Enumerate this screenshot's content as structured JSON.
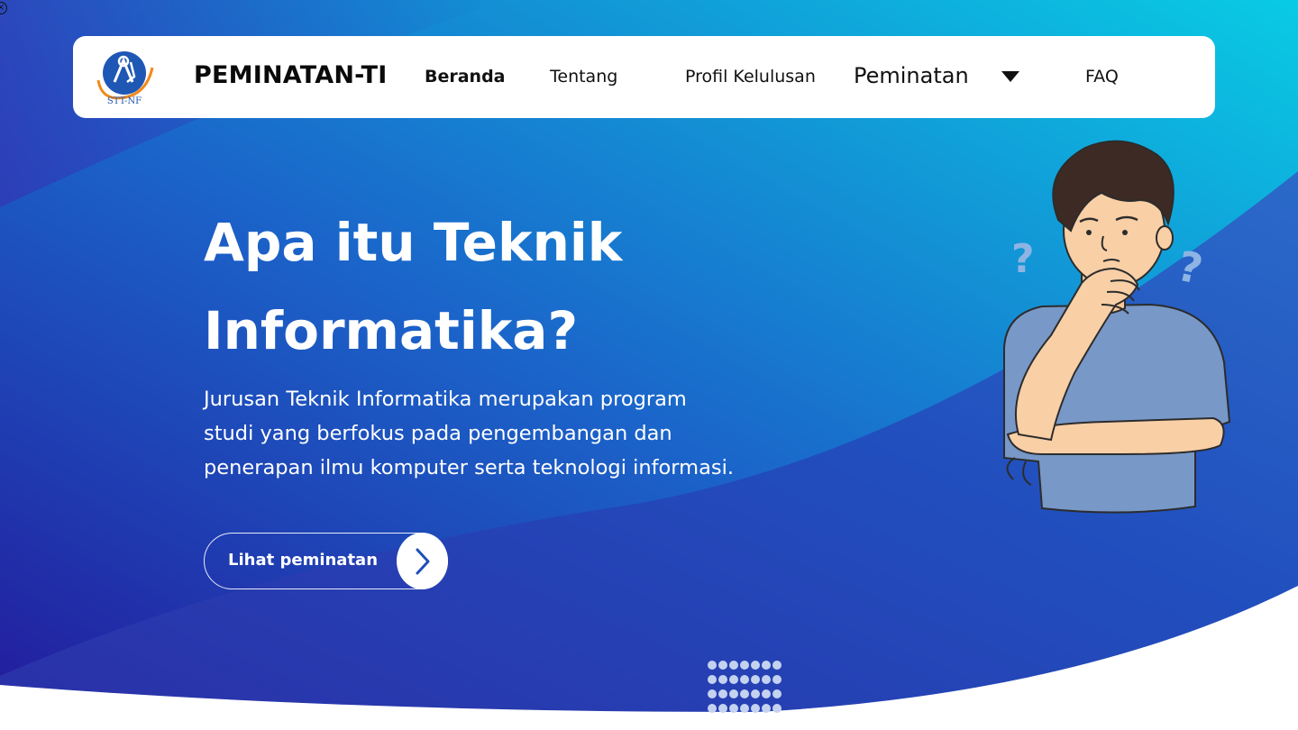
{
  "colors": {
    "gradient_start": "#2a1fa6",
    "gradient_mid": "#1d5fc8",
    "gradient_end": "#0ac6e2",
    "wave_dark": "#2c3fb4",
    "navbar_bg": "#ffffff",
    "text_light": "#ffffff",
    "logo_blue": "#1f57b5",
    "logo_orange": "#f08a1c"
  },
  "navbar": {
    "logo_text": "STT-NF",
    "brand": "PEMINATAN-TI",
    "items": [
      {
        "label": "Beranda",
        "active": true
      },
      {
        "label": "Tentang"
      },
      {
        "label": "Profil Kelulusan"
      },
      {
        "label": "Peminatan",
        "icon": "caret-down-icon"
      },
      {
        "label": "FAQ"
      }
    ]
  },
  "hero": {
    "title_line1": "Apa itu Teknik",
    "title_line2": "Informatika?",
    "description_line1": "Jurusan Teknik Informatika merupakan program",
    "description_line2": "studi yang berfokus pada pengembangan dan",
    "description_line3": "penerapan ilmu komputer serta teknologi informasi.",
    "cta_label": "Lihat peminatan",
    "cta_icon": "chevron-right-icon"
  },
  "illustration": {
    "name": "thinking-person-illustration",
    "icons": [
      "question-mark-icon",
      "question-mark-icon"
    ]
  }
}
